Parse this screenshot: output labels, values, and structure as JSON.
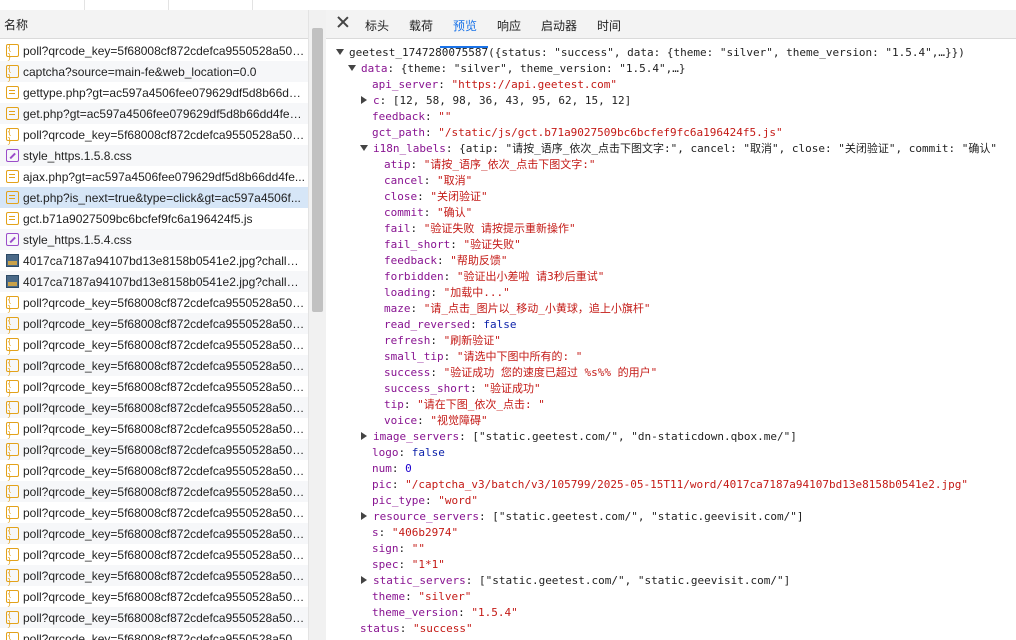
{
  "list": {
    "header": "名称",
    "items": [
      {
        "name": "poll?qrcode_key=5f68008cf872cdefca9550528a504f...",
        "icon": "fetch-icon"
      },
      {
        "name": "captcha?source=main-fe&web_location=0.0",
        "icon": "fetch-icon"
      },
      {
        "name": "gettype.php?gt=ac597a4506fee079629df5d8b66dd...",
        "icon": "document-icon"
      },
      {
        "name": "get.php?gt=ac597a4506fee079629df5d8b66dd4fe&...",
        "icon": "document-icon"
      },
      {
        "name": "poll?qrcode_key=5f68008cf872cdefca9550528a504f...",
        "icon": "fetch-icon"
      },
      {
        "name": "style_https.1.5.8.css",
        "icon": "stylesheet-icon"
      },
      {
        "name": "ajax.php?gt=ac597a4506fee079629df5d8b66dd4fe...",
        "icon": "document-icon"
      },
      {
        "name": "get.php?is_next=true&type=click&gt=ac597a4506f...",
        "icon": "document-icon"
      },
      {
        "name": "gct.b71a9027509bc6bcfef9fc6a196424f5.js",
        "icon": "document-icon"
      },
      {
        "name": "style_https.1.5.4.css",
        "icon": "stylesheet-icon"
      },
      {
        "name": "4017ca7187a94107bd13e8158b0541e2.jpg?challen...",
        "icon": "image-icon"
      },
      {
        "name": "4017ca7187a94107bd13e8158b0541e2.jpg?challen...",
        "icon": "image-icon"
      },
      {
        "name": "poll?qrcode_key=5f68008cf872cdefca9550528a504f...",
        "icon": "fetch-icon"
      },
      {
        "name": "poll?qrcode_key=5f68008cf872cdefca9550528a504f...",
        "icon": "fetch-icon"
      },
      {
        "name": "poll?qrcode_key=5f68008cf872cdefca9550528a504f...",
        "icon": "fetch-icon"
      },
      {
        "name": "poll?qrcode_key=5f68008cf872cdefca9550528a504f...",
        "icon": "fetch-icon"
      },
      {
        "name": "poll?qrcode_key=5f68008cf872cdefca9550528a504f...",
        "icon": "fetch-icon"
      },
      {
        "name": "poll?qrcode_key=5f68008cf872cdefca9550528a504f...",
        "icon": "fetch-icon"
      },
      {
        "name": "poll?qrcode_key=5f68008cf872cdefca9550528a504f...",
        "icon": "fetch-icon"
      },
      {
        "name": "poll?qrcode_key=5f68008cf872cdefca9550528a504f...",
        "icon": "fetch-icon"
      },
      {
        "name": "poll?qrcode_key=5f68008cf872cdefca9550528a504f...",
        "icon": "fetch-icon"
      },
      {
        "name": "poll?qrcode_key=5f68008cf872cdefca9550528a504f...",
        "icon": "fetch-icon"
      },
      {
        "name": "poll?qrcode_key=5f68008cf872cdefca9550528a504f...",
        "icon": "fetch-icon"
      },
      {
        "name": "poll?qrcode_key=5f68008cf872cdefca9550528a504f...",
        "icon": "fetch-icon"
      },
      {
        "name": "poll?qrcode_key=5f68008cf872cdefca9550528a504f...",
        "icon": "fetch-icon"
      },
      {
        "name": "poll?qrcode_key=5f68008cf872cdefca9550528a504f...",
        "icon": "fetch-icon"
      },
      {
        "name": "poll?qrcode_key=5f68008cf872cdefca9550528a504f...",
        "icon": "fetch-icon"
      },
      {
        "name": "poll?qrcode_key=5f68008cf872cdefca9550528a504f...",
        "icon": "fetch-icon"
      },
      {
        "name": "poll?qrcode_key=5f68008cf872cdefca9550528a504f...",
        "icon": "fetch-icon"
      }
    ],
    "selected_index": 7
  },
  "tabs": {
    "close_icon": "close-icon",
    "items": [
      "标头",
      "载荷",
      "预览",
      "响应",
      "启动器",
      "时间"
    ],
    "active_index": 2
  },
  "tree": [
    {
      "depth": 0,
      "arrow": "down",
      "parts": [
        {
          "c": "plain",
          "t": "geetest_1747280075587({status: \"success\", data: {theme: \"silver\", theme_version: \"1.5.4\",…}})"
        }
      ]
    },
    {
      "depth": 1,
      "arrow": "down",
      "parts": [
        {
          "c": "key",
          "t": "data"
        },
        {
          "c": "plain",
          "t": ": {theme: \"silver\", theme_version: \"1.5.4\",…}"
        }
      ]
    },
    {
      "depth": 2,
      "arrow": "none",
      "parts": [
        {
          "c": "key",
          "t": "api_server"
        },
        {
          "c": "plain",
          "t": ": "
        },
        {
          "c": "str",
          "t": "\"https://api.geetest.com\""
        }
      ]
    },
    {
      "depth": 2,
      "arrow": "right",
      "parts": [
        {
          "c": "key",
          "t": "c"
        },
        {
          "c": "plain",
          "t": ": [12, 58, 98, 36, 43, 95, 62, 15, 12]"
        }
      ]
    },
    {
      "depth": 2,
      "arrow": "none",
      "parts": [
        {
          "c": "key",
          "t": "feedback"
        },
        {
          "c": "plain",
          "t": ": "
        },
        {
          "c": "str",
          "t": "\"\""
        }
      ]
    },
    {
      "depth": 2,
      "arrow": "none",
      "parts": [
        {
          "c": "key",
          "t": "gct_path"
        },
        {
          "c": "plain",
          "t": ": "
        },
        {
          "c": "str",
          "t": "\"/static/js/gct.b71a9027509bc6bcfef9fc6a196424f5.js\""
        }
      ]
    },
    {
      "depth": 2,
      "arrow": "down",
      "parts": [
        {
          "c": "key",
          "t": "i18n_labels"
        },
        {
          "c": "plain",
          "t": ": {atip: \"请按_语序_依次_点击下图文字:\", cancel: \"取消\", close: \"关闭验证\", commit: \"确认\""
        }
      ]
    },
    {
      "depth": 3,
      "arrow": "none",
      "parts": [
        {
          "c": "key",
          "t": "atip"
        },
        {
          "c": "plain",
          "t": ": "
        },
        {
          "c": "str",
          "t": "\"请按_语序_依次_点击下图文字:\""
        }
      ]
    },
    {
      "depth": 3,
      "arrow": "none",
      "parts": [
        {
          "c": "key",
          "t": "cancel"
        },
        {
          "c": "plain",
          "t": ": "
        },
        {
          "c": "str",
          "t": "\"取消\""
        }
      ]
    },
    {
      "depth": 3,
      "arrow": "none",
      "parts": [
        {
          "c": "key",
          "t": "close"
        },
        {
          "c": "plain",
          "t": ": "
        },
        {
          "c": "str",
          "t": "\"关闭验证\""
        }
      ]
    },
    {
      "depth": 3,
      "arrow": "none",
      "parts": [
        {
          "c": "key",
          "t": "commit"
        },
        {
          "c": "plain",
          "t": ": "
        },
        {
          "c": "str",
          "t": "\"确认\""
        }
      ]
    },
    {
      "depth": 3,
      "arrow": "none",
      "parts": [
        {
          "c": "key",
          "t": "fail"
        },
        {
          "c": "plain",
          "t": ": "
        },
        {
          "c": "str",
          "t": "\"验证失败 请按提示重新操作\""
        }
      ]
    },
    {
      "depth": 3,
      "arrow": "none",
      "parts": [
        {
          "c": "key",
          "t": "fail_short"
        },
        {
          "c": "plain",
          "t": ": "
        },
        {
          "c": "str",
          "t": "\"验证失败\""
        }
      ]
    },
    {
      "depth": 3,
      "arrow": "none",
      "parts": [
        {
          "c": "key",
          "t": "feedback"
        },
        {
          "c": "plain",
          "t": ": "
        },
        {
          "c": "str",
          "t": "\"帮助反馈\""
        }
      ]
    },
    {
      "depth": 3,
      "arrow": "none",
      "parts": [
        {
          "c": "key",
          "t": "forbidden"
        },
        {
          "c": "plain",
          "t": ": "
        },
        {
          "c": "str",
          "t": "\"验证出小差啦 请3秒后重试\""
        }
      ]
    },
    {
      "depth": 3,
      "arrow": "none",
      "parts": [
        {
          "c": "key",
          "t": "loading"
        },
        {
          "c": "plain",
          "t": ": "
        },
        {
          "c": "str",
          "t": "\"加载中...\""
        }
      ]
    },
    {
      "depth": 3,
      "arrow": "none",
      "parts": [
        {
          "c": "key",
          "t": "maze"
        },
        {
          "c": "plain",
          "t": ": "
        },
        {
          "c": "str",
          "t": "\"请_点击_图片以_移动_小黄球，追上小旗杆\""
        }
      ]
    },
    {
      "depth": 3,
      "arrow": "none",
      "parts": [
        {
          "c": "key",
          "t": "read_reversed"
        },
        {
          "c": "plain",
          "t": ": "
        },
        {
          "c": "kw",
          "t": "false"
        }
      ]
    },
    {
      "depth": 3,
      "arrow": "none",
      "parts": [
        {
          "c": "key",
          "t": "refresh"
        },
        {
          "c": "plain",
          "t": ": "
        },
        {
          "c": "str",
          "t": "\"刷新验证\""
        }
      ]
    },
    {
      "depth": 3,
      "arrow": "none",
      "parts": [
        {
          "c": "key",
          "t": "small_tip"
        },
        {
          "c": "plain",
          "t": ": "
        },
        {
          "c": "str",
          "t": "\"请选中下图中所有的: \""
        }
      ]
    },
    {
      "depth": 3,
      "arrow": "none",
      "parts": [
        {
          "c": "key",
          "t": "success"
        },
        {
          "c": "plain",
          "t": ": "
        },
        {
          "c": "str",
          "t": "\"验证成功 您的速度已超过 %s%% 的用户\""
        }
      ]
    },
    {
      "depth": 3,
      "arrow": "none",
      "parts": [
        {
          "c": "key",
          "t": "success_short"
        },
        {
          "c": "plain",
          "t": ": "
        },
        {
          "c": "str",
          "t": "\"验证成功\""
        }
      ]
    },
    {
      "depth": 3,
      "arrow": "none",
      "parts": [
        {
          "c": "key",
          "t": "tip"
        },
        {
          "c": "plain",
          "t": ": "
        },
        {
          "c": "str",
          "t": "\"请在下图_依次_点击: \""
        }
      ]
    },
    {
      "depth": 3,
      "arrow": "none",
      "parts": [
        {
          "c": "key",
          "t": "voice"
        },
        {
          "c": "plain",
          "t": ": "
        },
        {
          "c": "str",
          "t": "\"视觉障碍\""
        }
      ]
    },
    {
      "depth": 2,
      "arrow": "right",
      "parts": [
        {
          "c": "key",
          "t": "image_servers"
        },
        {
          "c": "plain",
          "t": ": [\"static.geetest.com/\", \"dn-staticdown.qbox.me/\"]"
        }
      ]
    },
    {
      "depth": 2,
      "arrow": "none",
      "parts": [
        {
          "c": "key",
          "t": "logo"
        },
        {
          "c": "plain",
          "t": ": "
        },
        {
          "c": "kw",
          "t": "false"
        }
      ]
    },
    {
      "depth": 2,
      "arrow": "none",
      "parts": [
        {
          "c": "key",
          "t": "num"
        },
        {
          "c": "plain",
          "t": ": "
        },
        {
          "c": "num",
          "t": "0"
        }
      ]
    },
    {
      "depth": 2,
      "arrow": "none",
      "parts": [
        {
          "c": "key",
          "t": "pic"
        },
        {
          "c": "plain",
          "t": ": "
        },
        {
          "c": "str",
          "t": "\"/captcha_v3/batch/v3/105799/2025-05-15T11/word/4017ca7187a94107bd13e8158b0541e2.jpg\""
        }
      ]
    },
    {
      "depth": 2,
      "arrow": "none",
      "parts": [
        {
          "c": "key",
          "t": "pic_type"
        },
        {
          "c": "plain",
          "t": ": "
        },
        {
          "c": "str",
          "t": "\"word\""
        }
      ]
    },
    {
      "depth": 2,
      "arrow": "right",
      "parts": [
        {
          "c": "key",
          "t": "resource_servers"
        },
        {
          "c": "plain",
          "t": ": [\"static.geetest.com/\", \"static.geevisit.com/\"]"
        }
      ]
    },
    {
      "depth": 2,
      "arrow": "none",
      "parts": [
        {
          "c": "key",
          "t": "s"
        },
        {
          "c": "plain",
          "t": ": "
        },
        {
          "c": "str",
          "t": "\"406b2974\""
        }
      ]
    },
    {
      "depth": 2,
      "arrow": "none",
      "parts": [
        {
          "c": "key",
          "t": "sign"
        },
        {
          "c": "plain",
          "t": ": "
        },
        {
          "c": "str",
          "t": "\"\""
        }
      ]
    },
    {
      "depth": 2,
      "arrow": "none",
      "parts": [
        {
          "c": "key",
          "t": "spec"
        },
        {
          "c": "plain",
          "t": ": "
        },
        {
          "c": "str",
          "t": "\"1*1\""
        }
      ]
    },
    {
      "depth": 2,
      "arrow": "right",
      "parts": [
        {
          "c": "key",
          "t": "static_servers"
        },
        {
          "c": "plain",
          "t": ": [\"static.geetest.com/\", \"static.geevisit.com/\"]"
        }
      ]
    },
    {
      "depth": 2,
      "arrow": "none",
      "parts": [
        {
          "c": "key",
          "t": "theme"
        },
        {
          "c": "plain",
          "t": ": "
        },
        {
          "c": "str",
          "t": "\"silver\""
        }
      ]
    },
    {
      "depth": 2,
      "arrow": "none",
      "parts": [
        {
          "c": "key",
          "t": "theme_version"
        },
        {
          "c": "plain",
          "t": ": "
        },
        {
          "c": "str",
          "t": "\"1.5.4\""
        }
      ]
    },
    {
      "depth": 1,
      "arrow": "none",
      "parts": [
        {
          "c": "key",
          "t": "status"
        },
        {
          "c": "plain",
          "t": ": "
        },
        {
          "c": "str",
          "t": "\"success\""
        }
      ]
    }
  ]
}
